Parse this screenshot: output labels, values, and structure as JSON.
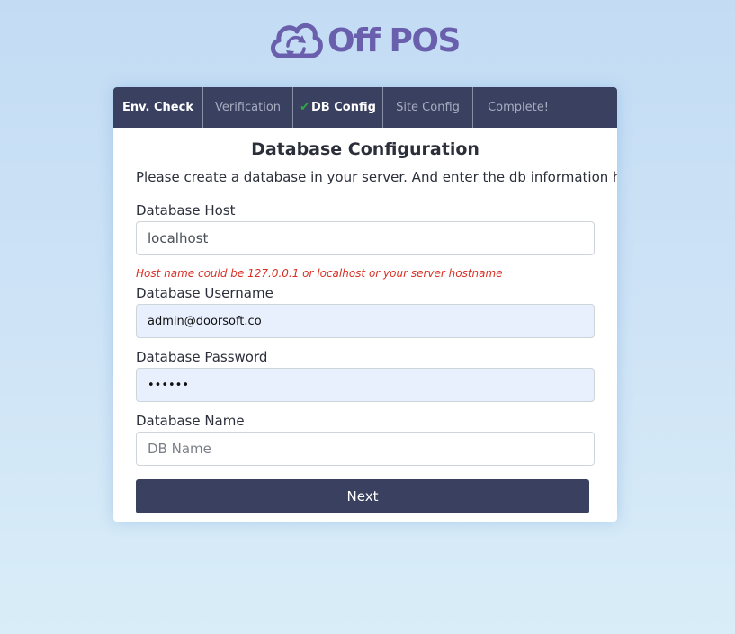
{
  "brand": {
    "name": "Off POS",
    "icon": "cloud-sync-icon",
    "color": "#6a5fad"
  },
  "steps": [
    {
      "label": "Env. Check",
      "done": false
    },
    {
      "label": "Verification",
      "done": false
    },
    {
      "label": "DB Config",
      "done": true
    },
    {
      "label": "Site Config",
      "done": false
    },
    {
      "label": "Complete!",
      "done": false
    }
  ],
  "form": {
    "title": "Database Configuration",
    "intro": "Please create a database in your server. And enter the db information here.",
    "host": {
      "label": "Database Host",
      "value": "localhost",
      "hint": "Host name could be 127.0.0.1 or localhost or your server hostname"
    },
    "username": {
      "label": "Database Username",
      "value": "admin@doorsoft.co"
    },
    "password": {
      "label": "Database Password",
      "value": "••••••"
    },
    "name": {
      "label": "Database Name",
      "value": "",
      "placeholder": "DB Name"
    },
    "submit_label": "Next"
  },
  "colors": {
    "header_bg": "#3a4060",
    "error": "#d93025",
    "check": "#2ea84a"
  }
}
